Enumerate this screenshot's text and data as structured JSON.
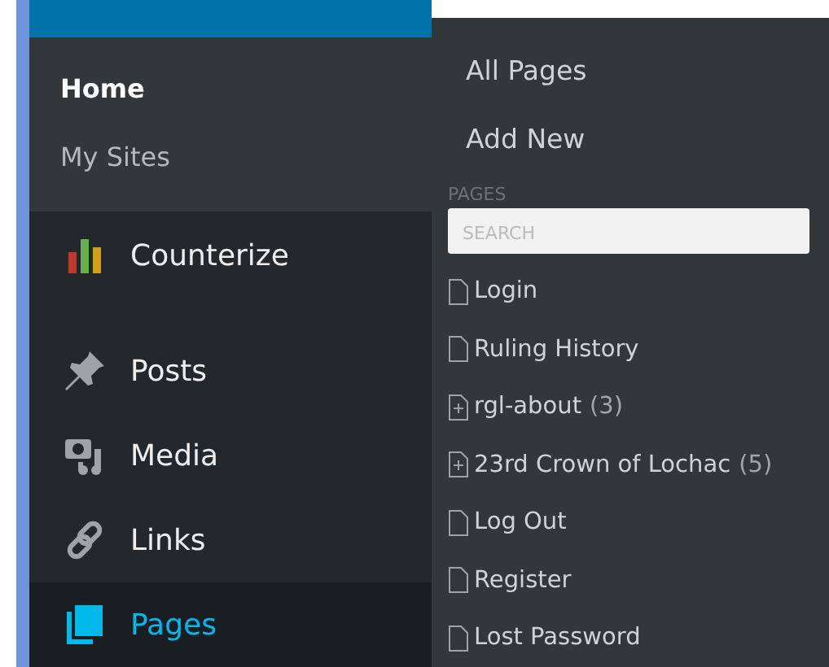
{
  "sidebar": {
    "submenu": [
      {
        "label": "Home",
        "selected": true
      },
      {
        "label": "My Sites",
        "selected": false
      }
    ],
    "items": [
      {
        "label": "Counterize",
        "kind": "chart",
        "selected": false
      },
      {
        "label": "Posts",
        "kind": "pin",
        "selected": false
      },
      {
        "label": "Media",
        "kind": "media",
        "selected": false
      },
      {
        "label": "Links",
        "kind": "link",
        "selected": false
      },
      {
        "label": "Pages",
        "kind": "pages",
        "selected": true
      }
    ]
  },
  "flyout": {
    "links": [
      "All Pages",
      "Add New"
    ],
    "section": "PAGES",
    "search": {
      "placeholder": "SEARCH"
    },
    "pages": [
      {
        "kind": "page",
        "title": "Login"
      },
      {
        "kind": "page",
        "title": "Ruling History"
      },
      {
        "kind": "parent",
        "title": "rgl-about",
        "count": "(3)"
      },
      {
        "kind": "parent",
        "title": "23rd Crown of Lochac",
        "count": "(5)"
      },
      {
        "kind": "page",
        "title": "Log Out"
      },
      {
        "kind": "page",
        "title": "Register"
      },
      {
        "kind": "page",
        "title": "Lost Password"
      }
    ]
  }
}
